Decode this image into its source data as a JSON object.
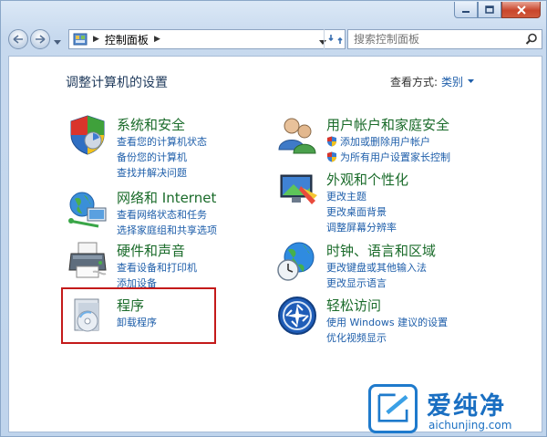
{
  "window": {
    "caption_buttons": [
      "minimize",
      "maximize",
      "close"
    ]
  },
  "nav": {
    "breadcrumb": [
      "控制面板"
    ],
    "search_placeholder": "搜索控制面板"
  },
  "main": {
    "title": "调整计算机的设置",
    "view_by_label": "查看方式:",
    "view_by_value": "类别"
  },
  "categories": [
    {
      "id": "system-security",
      "title": "系统和安全",
      "icon": "shield-icon",
      "links": [
        {
          "label": "查看您的计算机状态",
          "shield": false
        },
        {
          "label": "备份您的计算机",
          "shield": false
        },
        {
          "label": "查找并解决问题",
          "shield": false
        }
      ]
    },
    {
      "id": "network-internet",
      "title": "网络和 Internet",
      "icon": "network-icon",
      "links": [
        {
          "label": "查看网络状态和任务",
          "shield": false
        },
        {
          "label": "选择家庭组和共享选项",
          "shield": false
        }
      ]
    },
    {
      "id": "hardware-sound",
      "title": "硬件和声音",
      "icon": "printer-icon",
      "links": [
        {
          "label": "查看设备和打印机",
          "shield": false
        },
        {
          "label": "添加设备",
          "shield": false
        }
      ]
    },
    {
      "id": "programs",
      "title": "程序",
      "icon": "programs-icon",
      "links": [
        {
          "label": "卸载程序",
          "shield": false
        }
      ]
    },
    {
      "id": "user-accounts",
      "title": "用户帐户和家庭安全",
      "icon": "users-icon",
      "links": [
        {
          "label": "添加或删除用户帐户",
          "shield": true
        },
        {
          "label": "为所有用户设置家长控制",
          "shield": true
        }
      ]
    },
    {
      "id": "appearance",
      "title": "外观和个性化",
      "icon": "appearance-icon",
      "links": [
        {
          "label": "更改主题",
          "shield": false
        },
        {
          "label": "更改桌面背景",
          "shield": false
        },
        {
          "label": "调整屏幕分辨率",
          "shield": false
        }
      ]
    },
    {
      "id": "clock-language-region",
      "title": "时钟、语言和区域",
      "icon": "globe-clock-icon",
      "links": [
        {
          "label": "更改键盘或其他输入法",
          "shield": false
        },
        {
          "label": "更改显示语言",
          "shield": false
        }
      ]
    },
    {
      "id": "ease-of-access",
      "title": "轻松访问",
      "icon": "ease-of-access-icon",
      "links": [
        {
          "label": "使用 Windows 建议的设置",
          "shield": false
        },
        {
          "label": "优化视频显示",
          "shield": false
        }
      ]
    }
  ],
  "watermark": {
    "brand": "爱纯净",
    "url": "aichunjing.com"
  }
}
